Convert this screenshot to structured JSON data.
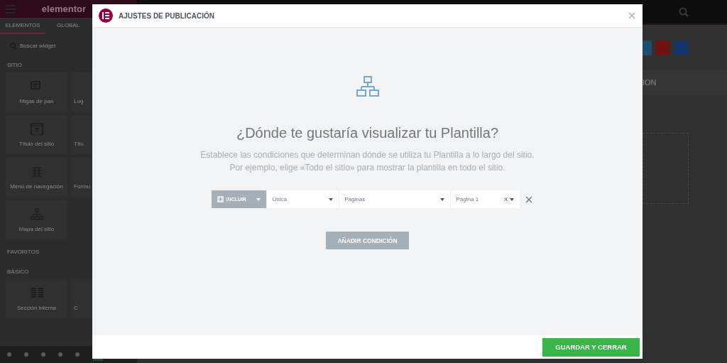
{
  "editor_panel": {
    "logo": "elementor",
    "tabs": [
      {
        "label": "ELEMENTOS",
        "selected": true
      },
      {
        "label": "GLOBAL",
        "selected": false
      }
    ],
    "search": {
      "placeholder": "Buscar widget"
    },
    "categories": [
      {
        "title": "SITIO",
        "widgets": [
          {
            "label": "Migas de pan",
            "kind": "breadcrumbs"
          },
          {
            "label": "Log"
          },
          {
            "label": "Título del sitio",
            "kind": "site-title"
          },
          {
            "label": "Títu"
          },
          {
            "label": "Menú de navegación",
            "kind": "nav-menu"
          },
          {
            "label": "Formu"
          },
          {
            "label": "Mapa del sitio",
            "kind": "sitemap"
          }
        ]
      },
      {
        "title": "FAVORITOS"
      },
      {
        "title": "BÁSICO",
        "widgets": [
          {
            "label": "Sección interna",
            "kind": "inner-section"
          },
          {
            "label": "C"
          }
        ]
      }
    ]
  },
  "page_preview": {
    "social_buttons": [
      {
        "color": "#1a4d70"
      },
      {
        "color": "#6e1212"
      },
      {
        "color": "#14336b"
      }
    ],
    "section_text": "ION"
  },
  "dialog": {
    "title": "AJUSTES DE PUBLICACIÓN",
    "heading": "¿Dónde te gustaría visualizar tu Plantilla?",
    "description": [
      "Establece las condiciones que determinan dónde se utiliza tu Plantilla a lo largo del sitio.",
      "Por ejemplo, elige «Todo el sitio» para mostrar la plantilla en todo el sitio."
    ],
    "conditions": [
      {
        "type": "INCLUIR",
        "fields": [
          {
            "value": "Única",
            "clearable": false
          },
          {
            "value": "Páginas",
            "clearable": false
          },
          {
            "value": "Página 1",
            "clearable": true
          }
        ]
      }
    ],
    "add_button": "AÑADIR CONDICIÓN",
    "save_button": "GUARDAR Y CERRAR"
  }
}
